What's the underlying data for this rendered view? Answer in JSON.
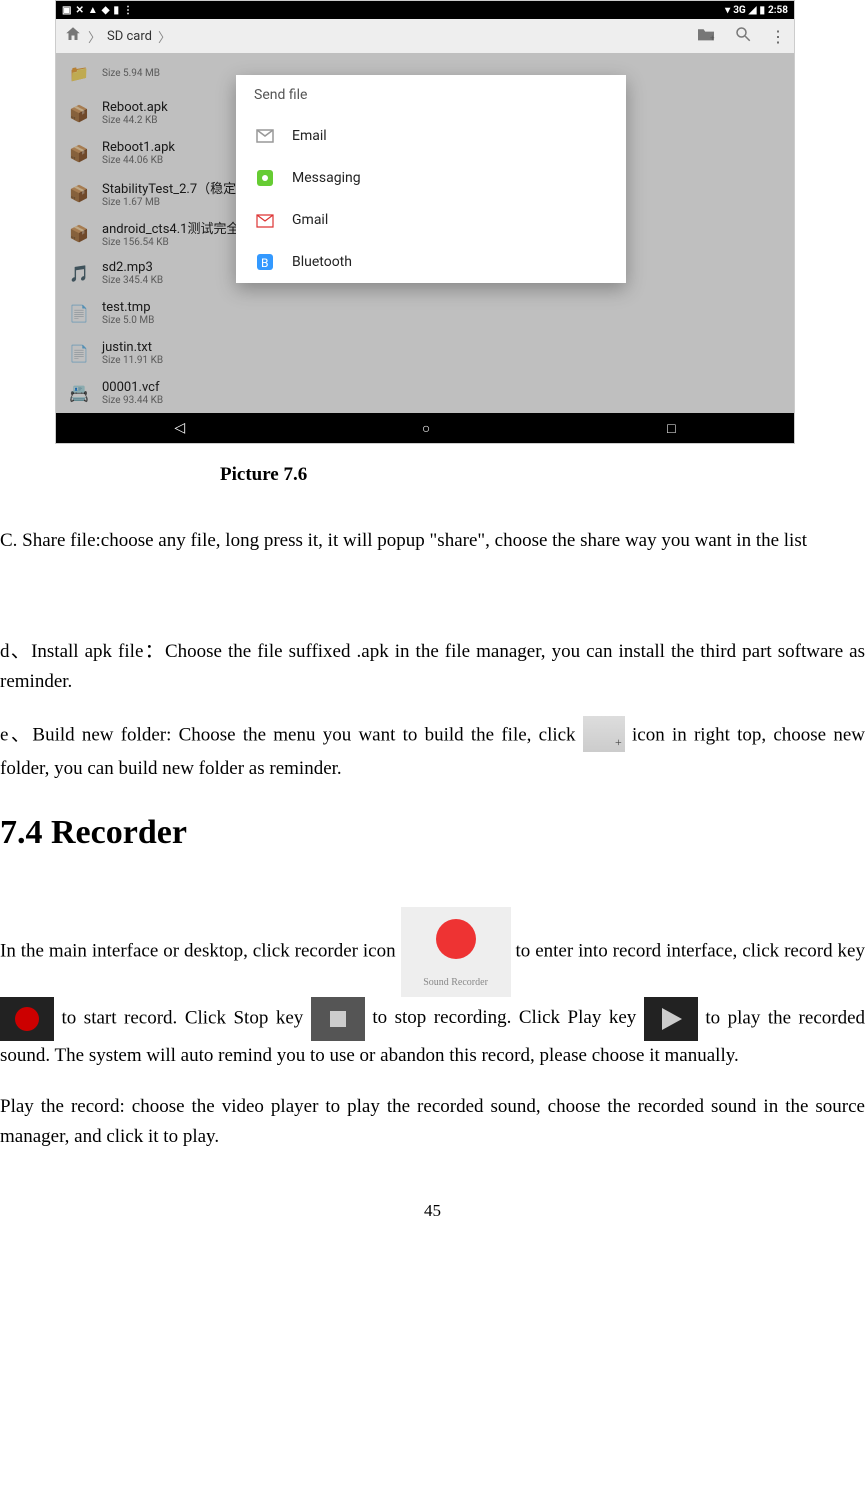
{
  "screenshot": {
    "statusbar": {
      "signal": "3G",
      "time": "2:58"
    },
    "breadcrumb": {
      "root": "SD card"
    },
    "files": [
      {
        "name": "",
        "size": "Size 5.94 MB"
      },
      {
        "name": "Reboot.apk",
        "size": "Size 44.2 KB"
      },
      {
        "name": "Reboot1.apk",
        "size": "Size 44.06 KB"
      },
      {
        "name": "StabilityTest_2.7（稳定性）.apk",
        "size": "Size 1.67 MB"
      },
      {
        "name": "android_cts4.1测试完全",
        "size": "Size 156.54 KB"
      },
      {
        "name": "sd2.mp3",
        "size": "Size 345.4 KB"
      },
      {
        "name": "test.tmp",
        "size": "Size 5.0 MB"
      },
      {
        "name": "justin.txt",
        "size": "Size 11.91 KB"
      },
      {
        "name": "00001.vcf",
        "size": "Size 93.44 KB"
      }
    ],
    "dialog": {
      "title": "Send file",
      "items": [
        {
          "label": "Email"
        },
        {
          "label": "Messaging"
        },
        {
          "label": "Gmail"
        },
        {
          "label": "Bluetooth"
        }
      ]
    }
  },
  "caption": "Picture 7.6",
  "paraC": "C. Share file:choose any file, long press it, it will popup \"share\", choose the share way you want in the list",
  "paraD": "d、Install apk file：Choose the file suffixed .apk in the file manager, you can install the third part software as reminder.",
  "paraE1": "e、Build new folder: Choose the menu you want to build the file, click ",
  "paraE2": " icon in right top, choose new folder, you can build new folder as reminder.",
  "section": "7.4 Recorder",
  "rec": {
    "t1": "In the main interface or desktop, click recorder icon ",
    "iconLabel": "Sound Recorder",
    "t2": " to enter into record interface, ",
    "t3": "click record key ",
    "t4": " to start record. Click Stop key ",
    "t5": " to stop recording. Click Play key ",
    "t6": " to play the recorded sound. The system will auto remind you to use or abandon this record, please choose it manually.",
    "t7": "Play the record: choose the video player to play the recorded sound, choose the recorded sound in the source manager, and click it to play."
  },
  "pageNumber": "45"
}
